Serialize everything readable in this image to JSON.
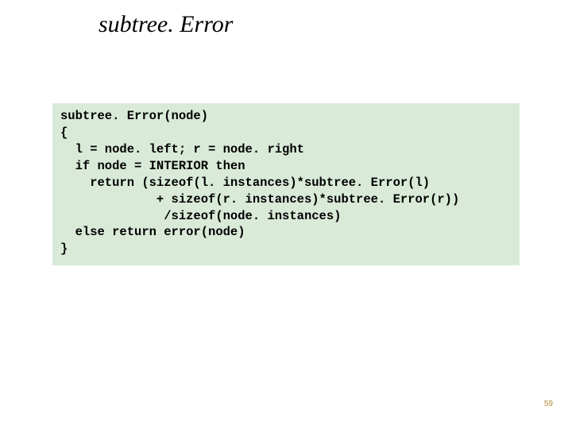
{
  "title": "subtree. Error",
  "code": {
    "l1": "subtree. Error(node)",
    "l2": "{",
    "l3": "  l = node. left; r = node. right",
    "l4": "  if node = INTERIOR then",
    "l5": "    return (sizeof(l. instances)*subtree. Error(l)",
    "l6": "             + sizeof(r. instances)*subtree. Error(r))",
    "l7": "              /sizeof(node. instances)",
    "l8": "  else return error(node)",
    "l9": "}"
  },
  "pagenum": "59"
}
